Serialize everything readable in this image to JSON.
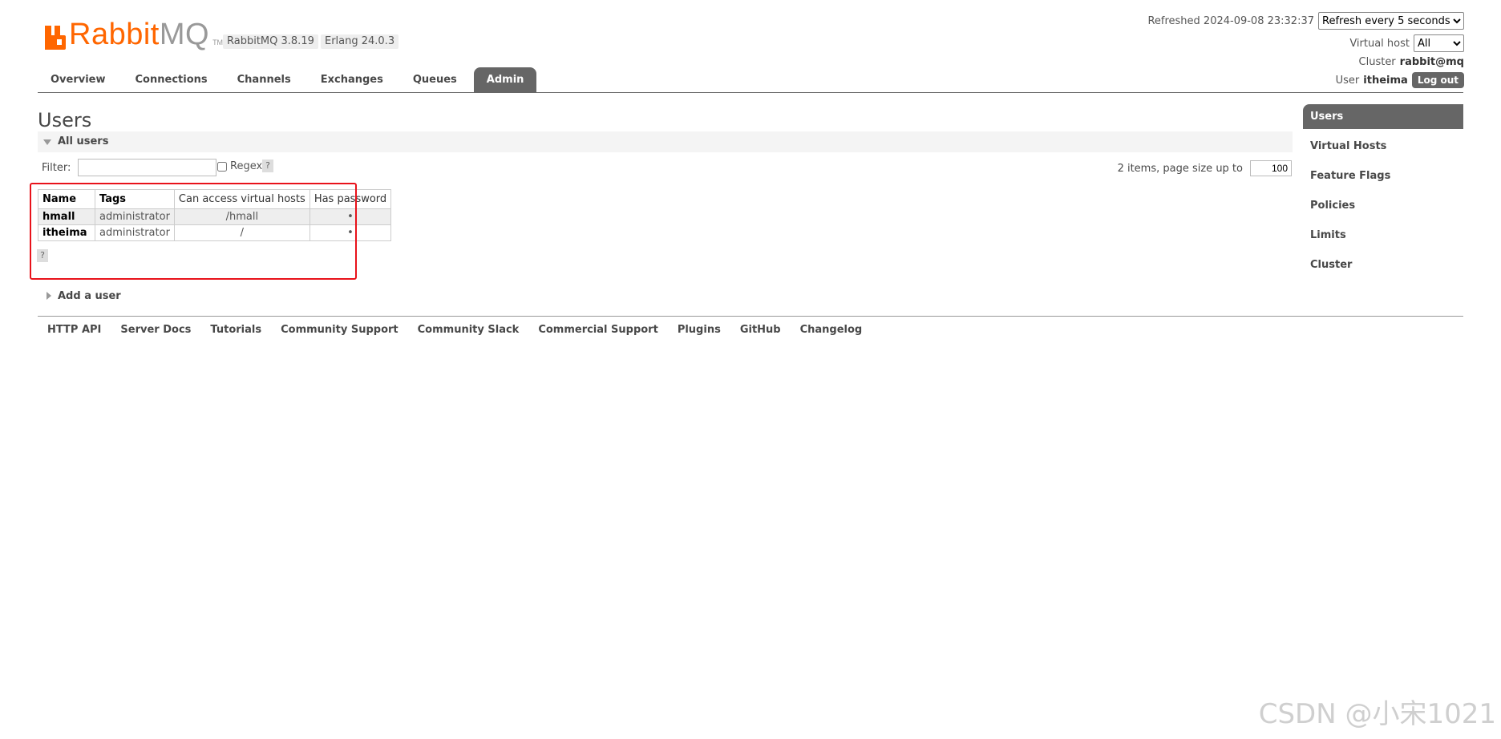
{
  "brand": {
    "rabbit": "Rabbit",
    "mq": "MQ",
    "tm": "TM"
  },
  "versions": {
    "rabbitmq": "RabbitMQ 3.8.19",
    "erlang": "Erlang 24.0.3"
  },
  "status": {
    "refreshed": "Refreshed 2024-09-08 23:32:37",
    "refresh_option": "Refresh every 5 seconds",
    "vhost_label": "Virtual host",
    "vhost_value": "All",
    "cluster_label": "Cluster",
    "cluster_value": "rabbit@mq",
    "user_label": "User",
    "user_value": "itheima",
    "logout": "Log out"
  },
  "tabs": [
    {
      "label": "Overview"
    },
    {
      "label": "Connections"
    },
    {
      "label": "Channels"
    },
    {
      "label": "Exchanges"
    },
    {
      "label": "Queues"
    },
    {
      "label": "Admin"
    }
  ],
  "active_tab": "Admin",
  "main": {
    "title": "Users",
    "section_label": "All users",
    "filter_label": "Filter:",
    "filter_value": "",
    "regex_label": "Regex",
    "help": "?",
    "items_info": "2 items, page size up to",
    "page_size": "100",
    "table": {
      "headers": [
        "Name",
        "Tags",
        "Can access virtual hosts",
        "Has password"
      ],
      "rows": [
        {
          "name": "hmall",
          "tags": "administrator",
          "vhosts": "/hmall",
          "has_password": "•"
        },
        {
          "name": "itheima",
          "tags": "administrator",
          "vhosts": "/",
          "has_password": "•"
        }
      ]
    },
    "add_user": "Add a user"
  },
  "footer_links": [
    "HTTP API",
    "Server Docs",
    "Tutorials",
    "Community Support",
    "Community Slack",
    "Commercial Support",
    "Plugins",
    "GitHub",
    "Changelog"
  ],
  "sidebar": {
    "items": [
      {
        "label": "Users"
      },
      {
        "label": "Virtual Hosts"
      },
      {
        "label": "Feature Flags"
      },
      {
        "label": "Policies"
      },
      {
        "label": "Limits"
      },
      {
        "label": "Cluster"
      }
    ],
    "active": "Users"
  },
  "watermark": "CSDN @小宋1021",
  "colors": {
    "brand": "#ff6600",
    "tab_active": "#666666",
    "highlight_box": "#e8121a"
  }
}
